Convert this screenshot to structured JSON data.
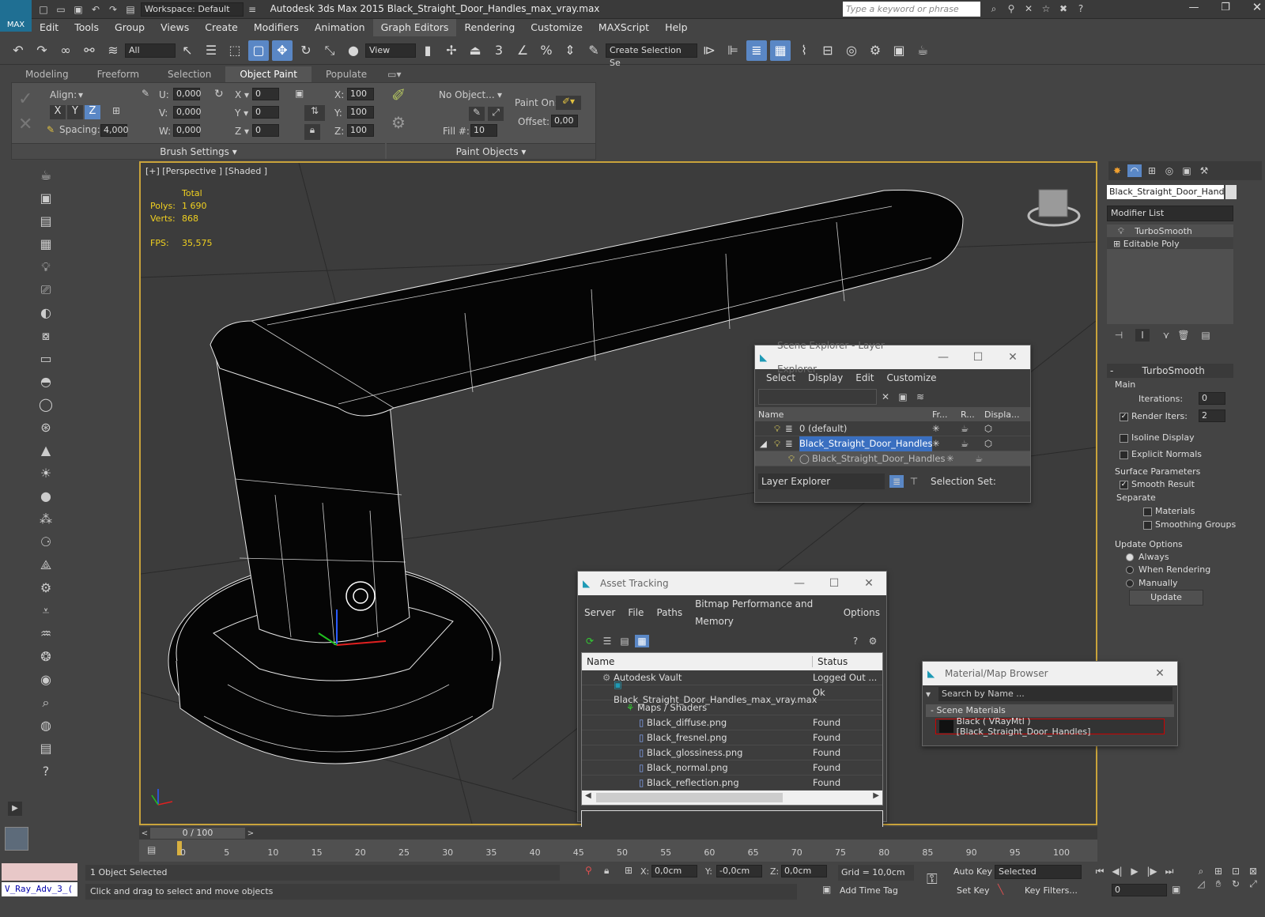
{
  "title": "Autodesk 3ds Max  2015     Black_Straight_Door_Handles_max_vray.max",
  "workspace": "Workspace: Default",
  "search_placeholder": "Type a keyword or phrase",
  "menu": [
    "Edit",
    "Tools",
    "Group",
    "Views",
    "Create",
    "Modifiers",
    "Animation",
    "Graph Editors",
    "Rendering",
    "Customize",
    "MAXScript",
    "Help"
  ],
  "toolbar": {
    "filter": "All",
    "refcoord": "View",
    "selset": "Create Selection Se"
  },
  "ribbon": {
    "tabs": [
      "Modeling",
      "Freeform",
      "Selection",
      "Object Paint",
      "Populate"
    ],
    "align": "Align:",
    "spacing_label": "Spacing:",
    "spacing": "4,000",
    "u": "0,000",
    "v": "0,000",
    "w": "0,000",
    "xr": "0",
    "yr": "0",
    "zr": "0",
    "xs": "100",
    "ys": "100",
    "zs": "100",
    "no_object": "No Object...",
    "fill_label": "Fill #:",
    "fill": "10",
    "paint_on": "Paint On:",
    "offset_label": "Offset:",
    "offset": "0,00",
    "brush_settings": "Brush Settings",
    "paint_objects": "Paint Objects"
  },
  "viewport": {
    "label": "[+] [Perspective ] [Shaded ]",
    "total": "Total",
    "polys_label": "Polys:",
    "polys": "1 690",
    "verts_label": "Verts:",
    "verts": "868",
    "fps_label": "FPS:",
    "fps": "35,575"
  },
  "cmd": {
    "object_name": "Black_Straight_Door_Handles",
    "modifier_list": "Modifier List",
    "stack": [
      "TurboSmooth",
      "Editable Poly"
    ],
    "rollout": "TurboSmooth",
    "main": "Main",
    "iterations_label": "Iterations:",
    "iterations": "0",
    "render_iters_label": "Render Iters:",
    "render_iters": "2",
    "isoline": "Isoline Display",
    "explicit": "Explicit Normals",
    "surface": "Surface Parameters",
    "smooth_result": "Smooth Result",
    "separate": "Separate",
    "materials": "Materials",
    "smoothing": "Smoothing Groups",
    "update_options": "Update Options",
    "always": "Always",
    "when_rendering": "When Rendering",
    "manually": "Manually",
    "update": "Update"
  },
  "scene_explorer": {
    "title": "Scene Explorer - Layer Explorer",
    "menu": [
      "Select",
      "Display",
      "Edit",
      "Customize"
    ],
    "cols": [
      "Name",
      "Fr...",
      "R...",
      "Displa..."
    ],
    "rows": [
      "0 (default)",
      "Black_Straight_Door_Handles",
      "Black_Straight_Door_Handles"
    ],
    "footer": "Layer Explorer",
    "selset": "Selection Set:"
  },
  "asset": {
    "title": "Asset Tracking",
    "menu": [
      "Server",
      "File",
      "Paths",
      "Bitmap Performance and Memory",
      "Options"
    ],
    "cols": [
      "Name",
      "Status"
    ],
    "rows": [
      {
        "name": "Autodesk Vault",
        "status": "Logged Out ..."
      },
      {
        "name": "Black_Straight_Door_Handles_max_vray.max",
        "status": "Ok"
      },
      {
        "name": "Maps / Shaders",
        "status": ""
      },
      {
        "name": "Black_diffuse.png",
        "status": "Found"
      },
      {
        "name": "Black_fresnel.png",
        "status": "Found"
      },
      {
        "name": "Black_glossiness.png",
        "status": "Found"
      },
      {
        "name": "Black_normal.png",
        "status": "Found"
      },
      {
        "name": "Black_reflection.png",
        "status": "Found"
      }
    ]
  },
  "material": {
    "title": "Material/Map Browser",
    "search": "Search by Name ...",
    "section": "- Scene Materials",
    "item": "Black  ( VRayMtl )  [Black_Straight_Door_Handles]"
  },
  "timeline": {
    "frame": "0 / 100",
    "ticks": [
      "0",
      "5",
      "10",
      "15",
      "20",
      "25",
      "30",
      "35",
      "40",
      "45",
      "50",
      "55",
      "60",
      "65",
      "70",
      "75",
      "80",
      "85",
      "90",
      "95",
      "100"
    ]
  },
  "status": {
    "script": "V_Ray_Adv_3_(",
    "selected": "1 Object Selected",
    "prompt": "Click and drag to select and move objects",
    "x_label": "X:",
    "x": "0,0cm",
    "y_label": "Y:",
    "y": "-0,0cm",
    "z_label": "Z:",
    "z": "0,0cm",
    "grid": "Grid = 10,0cm",
    "autokey": "Auto Key",
    "selected_dd": "Selected",
    "setkey": "Set Key",
    "keyfilters": "Key Filters...",
    "addtimetag": "Add Time Tag",
    "frame": "0"
  }
}
